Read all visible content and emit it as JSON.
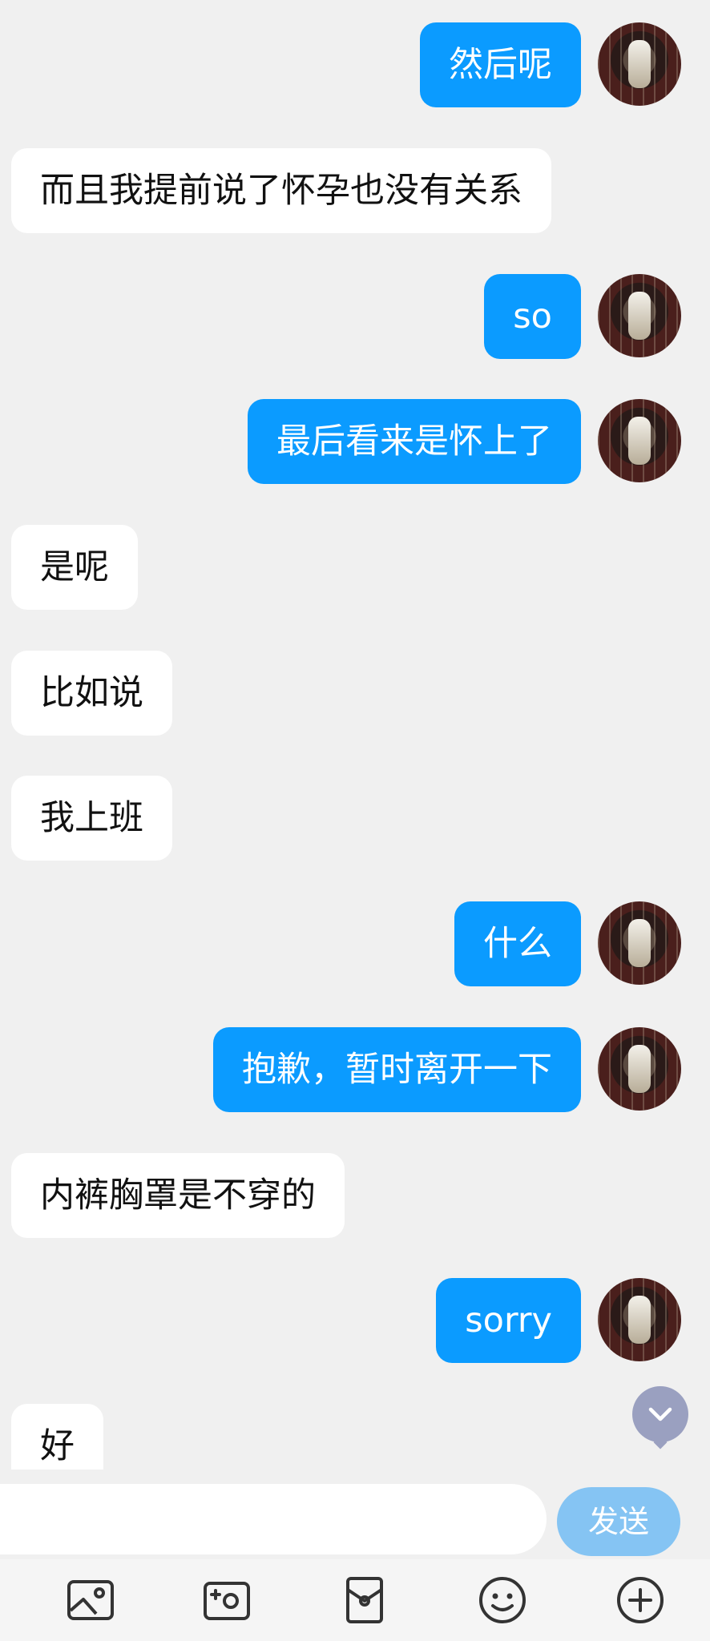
{
  "messages": [
    {
      "side": "right",
      "text": "然后呢"
    },
    {
      "side": "left",
      "text": "而且我提前说了怀孕也没有关系"
    },
    {
      "side": "right",
      "text": "so"
    },
    {
      "side": "right",
      "text": "最后看来是怀上了"
    },
    {
      "side": "left",
      "text": "是呢"
    },
    {
      "side": "left",
      "text": "比如说"
    },
    {
      "side": "left",
      "text": "我上班"
    },
    {
      "side": "right",
      "text": "什么"
    },
    {
      "side": "right",
      "text": "抱歉，暂时离开一下"
    },
    {
      "side": "left",
      "text": "内裤胸罩是不穿的"
    },
    {
      "side": "right",
      "text": "sorry"
    },
    {
      "side": "left",
      "text": "好"
    }
  ],
  "composer": {
    "input_value": "",
    "input_placeholder": "",
    "send_label": "发送"
  },
  "toolbar": {
    "icons": [
      "image-icon",
      "camera-icon",
      "red-packet-icon",
      "emoji-icon",
      "plus-icon"
    ]
  },
  "colors": {
    "outgoing_bubble": "#0b9bff",
    "incoming_bubble": "#ffffff",
    "send_button": "#85c4f3",
    "background": "#f0f0f0"
  }
}
